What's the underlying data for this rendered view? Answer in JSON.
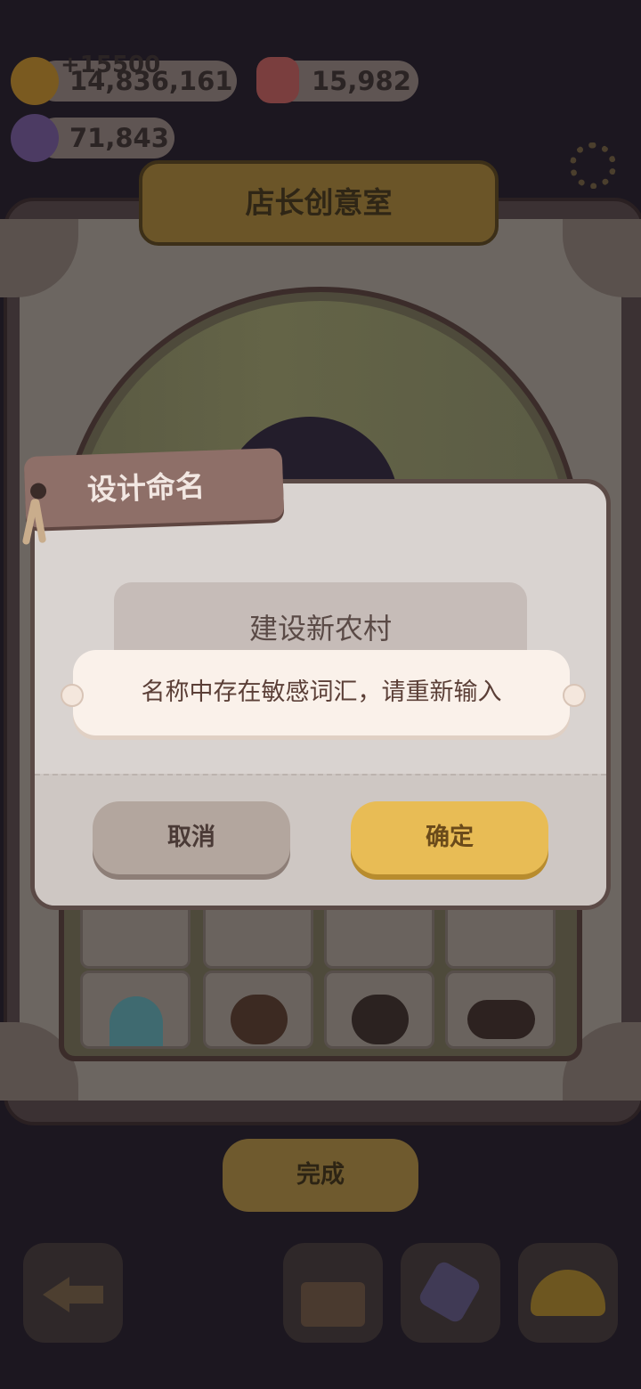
{
  "hud": {
    "coins": {
      "value": "14,836,161",
      "gain": "+15500",
      "icon": "cookie-coin-icon"
    },
    "gems": {
      "value": "15,982",
      "icon": "jelly-gem-icon"
    },
    "candy": {
      "value": "71,843",
      "icon": "candy-icon"
    }
  },
  "studio": {
    "title": "店长创意室",
    "done_label": "完成"
  },
  "dialog": {
    "tag_label": "设计命名",
    "name_value": "建设新农村",
    "toast": "名称中存在敏感词汇，请重新输入",
    "cancel_label": "取消",
    "confirm_label": "确定"
  },
  "colors": {
    "dialog_bg": "#d9d3d0",
    "confirm_button": "#e8bc55",
    "cancel_button": "#b3a69e",
    "tag": "#8e6f68",
    "toast_bg": "#faf1ea"
  },
  "bottom_bar": {
    "icons": [
      "back-arrow-icon",
      "outfit-box-icon",
      "makeup-tools-icon",
      "hat-icon"
    ]
  }
}
